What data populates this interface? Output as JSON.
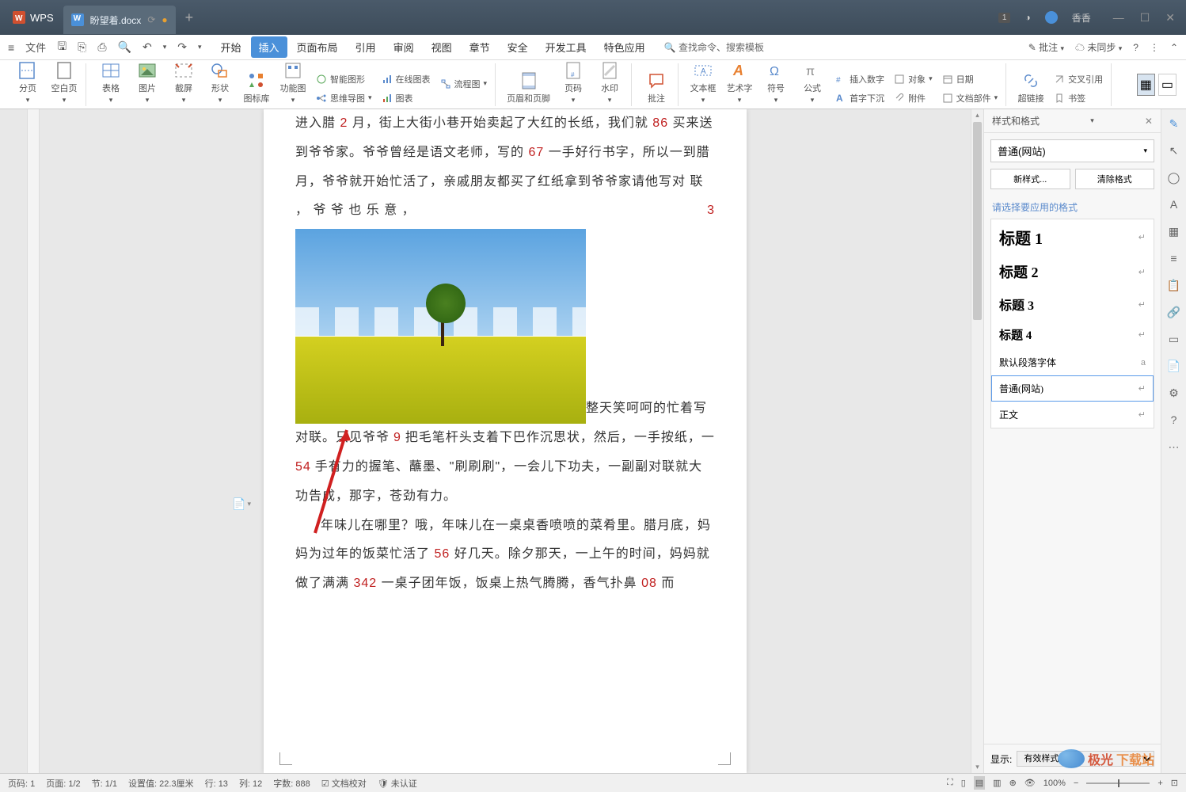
{
  "titlebar": {
    "app_name": "WPS",
    "tab_name": "盼望着.docx",
    "user_name": "香香",
    "notif_badge": "1"
  },
  "file_menu_label": "文件",
  "menu": {
    "items": [
      "开始",
      "插入",
      "页面布局",
      "引用",
      "审阅",
      "视图",
      "章节",
      "安全",
      "开发工具",
      "特色应用"
    ],
    "active_index": 1,
    "search_placeholder": "查找命令、搜索模板",
    "annotate": "批注",
    "sync": "未同步"
  },
  "ribbon": {
    "section_break": "分页",
    "blank_page": "空白页",
    "table": "表格",
    "picture": "图片",
    "screenshot": "截屏",
    "shape": "形状",
    "icon_lib": "图标库",
    "function_chart": "功能图",
    "smart_graphic": "智能图形",
    "online_chart": "在线图表",
    "flowchart": "流程图",
    "mindmap": "思维导图",
    "chart": "图表",
    "header_footer": "页眉和页脚",
    "page_number": "页码",
    "watermark": "水印",
    "comment": "批注",
    "textbox": "文本框",
    "wordart": "艺术字",
    "symbol": "符号",
    "formula": "公式",
    "insert_number": "插入数字",
    "object": "对象",
    "date": "日期",
    "dropcap": "首字下沉",
    "attachment": "附件",
    "doc_parts": "文档部件",
    "hyperlink": "超链接",
    "cross_ref": "交叉引用",
    "bookmark": "书签"
  },
  "document": {
    "para1_a": "进入腊",
    "para1_n1": "2",
    "para1_b": "月，街上大街小巷开始卖起了大红的长纸，我们就",
    "para1_n2": "86",
    "para1_c": "买来送到爷爷家。爷爷曾经是语文老师，写的",
    "para1_n3": "67",
    "para1_d": "一手好行书字，所以一到腊月，爷爷就开始忙活了，亲戚朋友都买了红纸拿到爷爷家请他写对 联 ， 爷 爷 也 乐 意 ，",
    "para1_n4": "3",
    "para2_a": "整天笑呵呵的忙着写对联。只见爷爷",
    "para2_n1": "9",
    "para2_b": "把毛笔杆头支着下巴作沉思状，然后，一手按纸，一",
    "para2_n2": "54",
    "para2_c": "手有力的握笔、蘸墨、\"刷刷刷\"，一会儿下功夫，一副副对联就大功告成，那字，苍劲有力。",
    "para3_a": "年味儿在哪里？哦，年味儿在一桌桌香喷喷的菜肴里。腊月底，妈妈为过年的饭菜忙活了",
    "para3_n1": "56",
    "para3_b": "好几天。除夕那天，一上午的时间，妈妈就做了满满",
    "para3_n2": "342",
    "para3_c": "一桌子团年饭，饭桌上热气腾腾，香气扑鼻",
    "para3_n3": "08",
    "para3_d": "而"
  },
  "styles_pane": {
    "title": "样式和格式",
    "current_style": "普通(网站)",
    "new_style_btn": "新样式...",
    "clear_format_btn": "清除格式",
    "select_label": "请选择要应用的格式",
    "style_h1": "标题 1",
    "style_h2": "标题 2",
    "style_h3": "标题 3",
    "style_h4": "标题 4",
    "style_default_font": "默认段落字体",
    "style_normal_web": "普通(网站)",
    "style_body": "正文",
    "show_label": "显示:",
    "show_value": "有效样式"
  },
  "statusbar": {
    "page_code": "页码: 1",
    "page": "页面: 1/2",
    "section": "节: 1/1",
    "position": "设置值: 22.3厘米",
    "line": "行: 13",
    "column": "列: 12",
    "word_count": "字数: 888",
    "doc_check": "文档校对",
    "not_verified": "未认证",
    "zoom": "100%"
  },
  "watermark": {
    "text1": "极光",
    "text2": "下载站"
  }
}
